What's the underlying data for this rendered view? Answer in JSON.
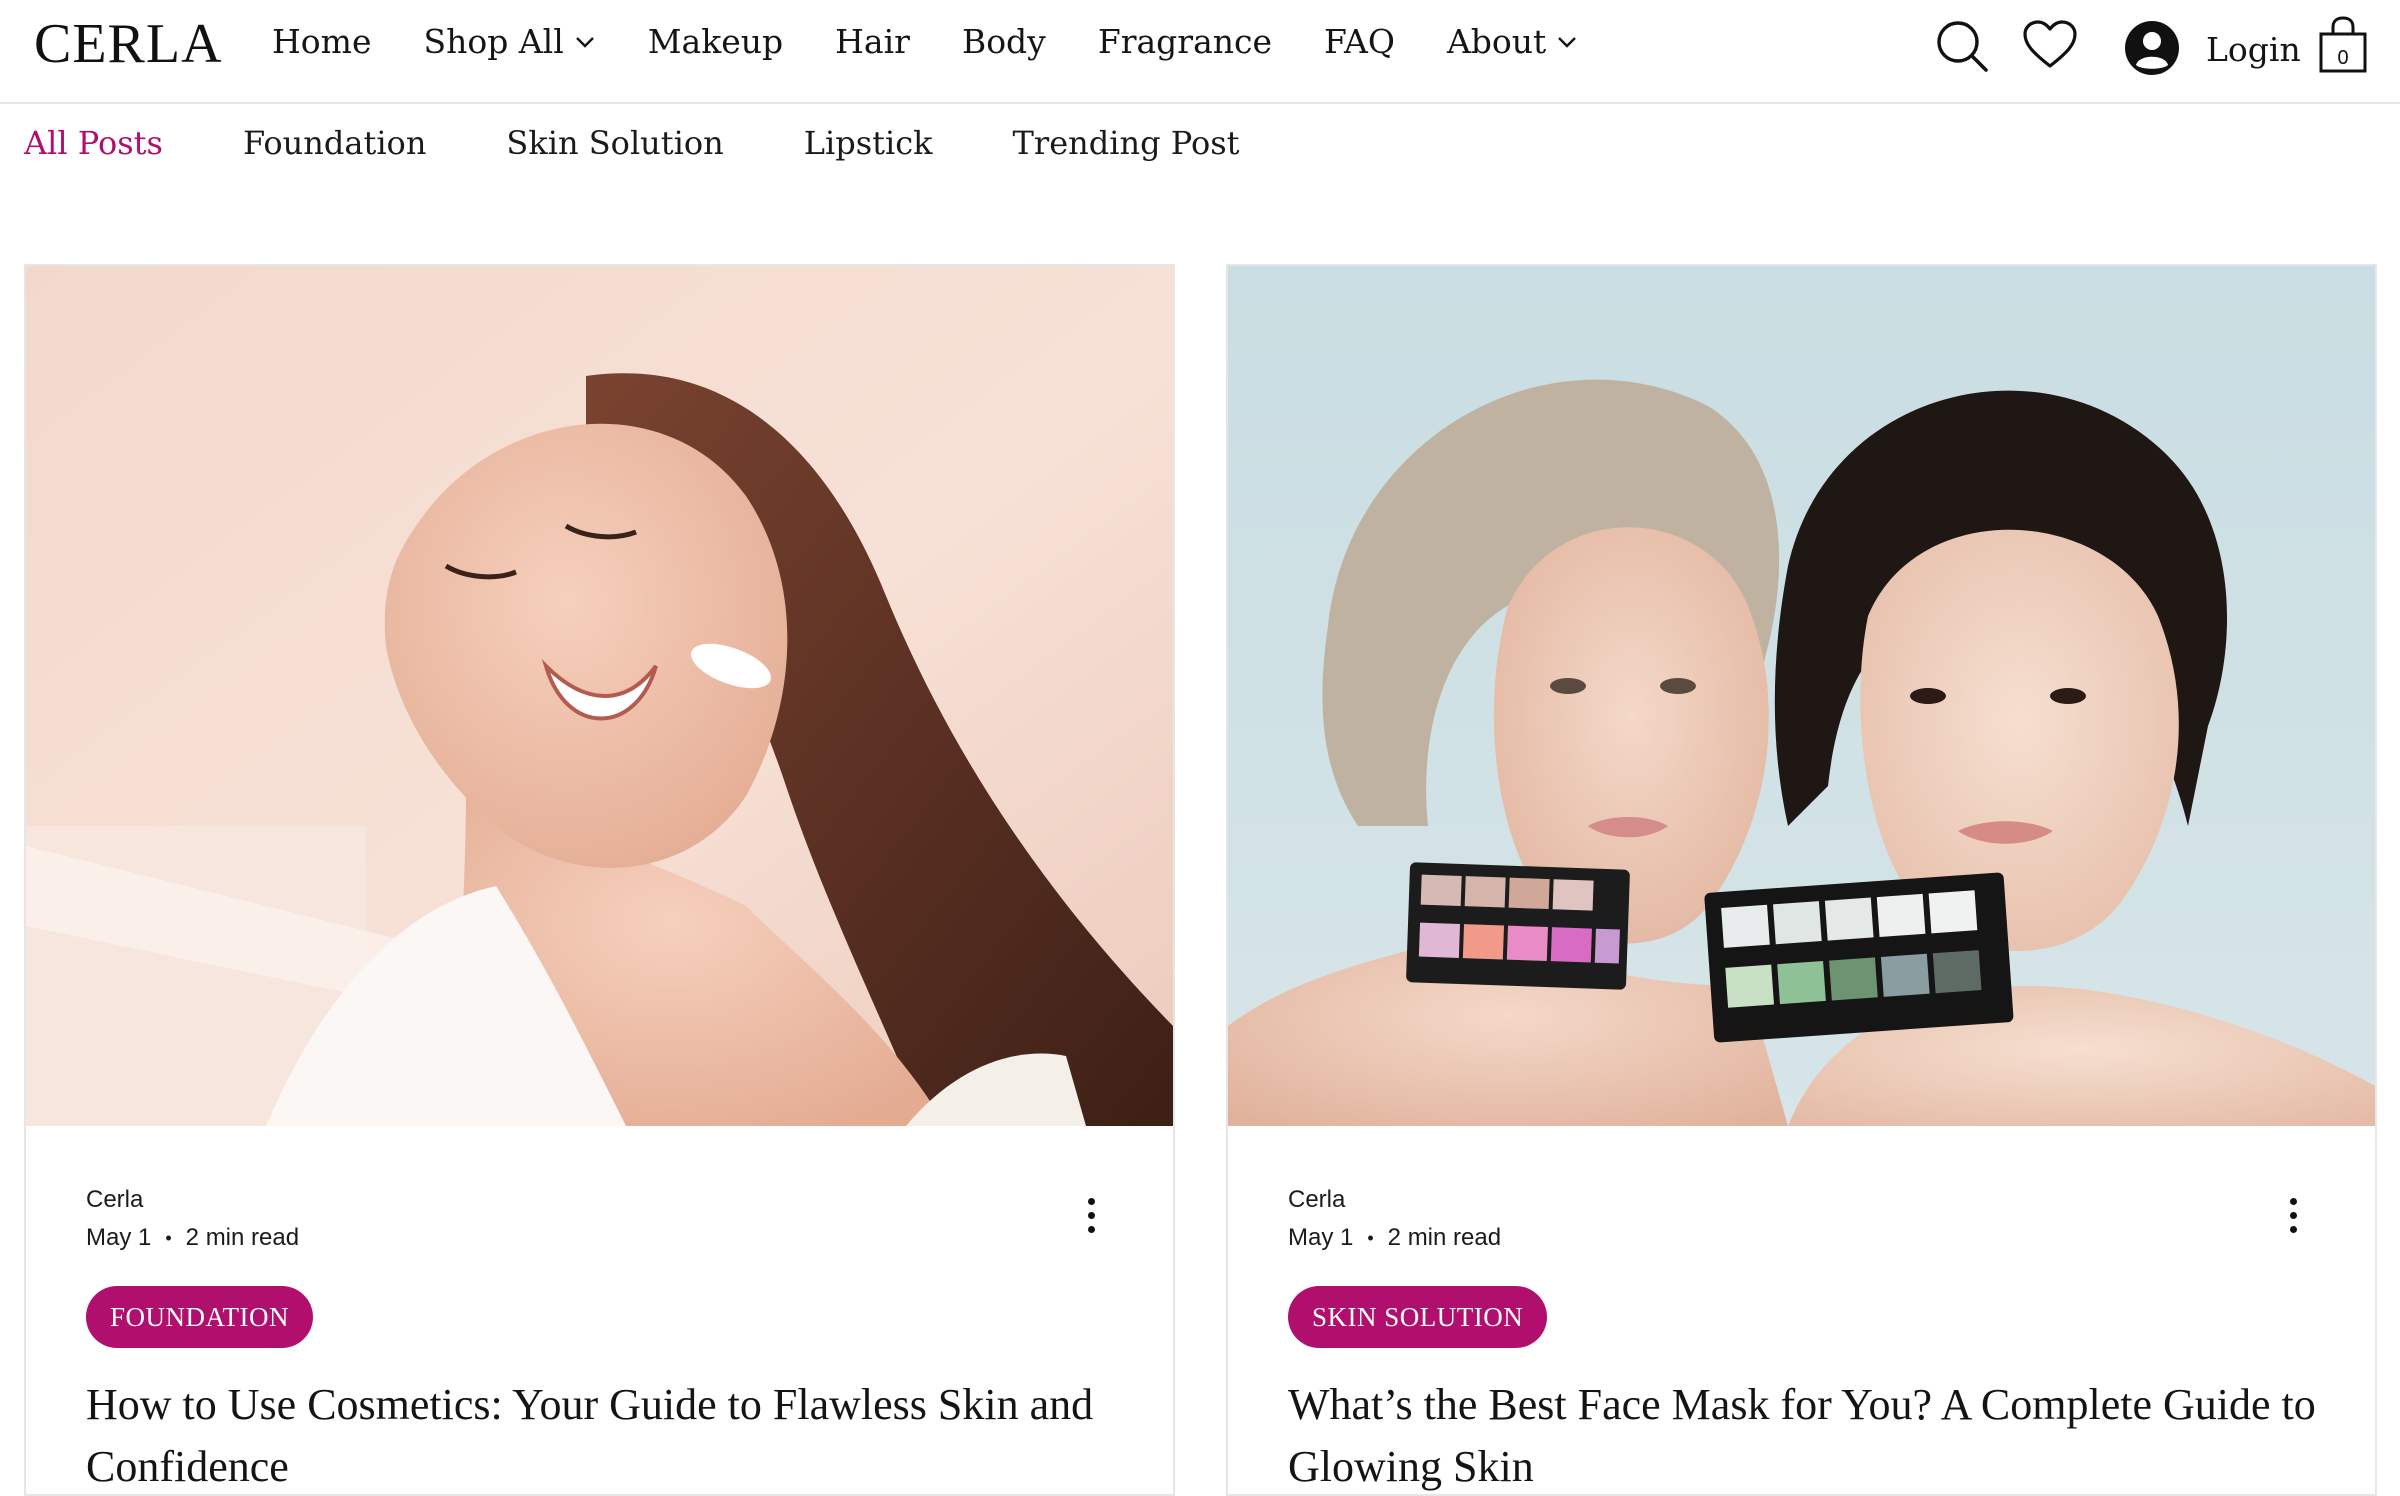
{
  "header": {
    "logo": "CERLA",
    "nav": [
      {
        "label": "Home",
        "dropdown": false
      },
      {
        "label": "Shop All",
        "dropdown": true
      },
      {
        "label": "Makeup",
        "dropdown": false
      },
      {
        "label": "Hair",
        "dropdown": false
      },
      {
        "label": "Body",
        "dropdown": false
      },
      {
        "label": "Fragrance",
        "dropdown": false
      },
      {
        "label": "FAQ",
        "dropdown": false
      },
      {
        "label": "About",
        "dropdown": true
      }
    ],
    "login_label": "Login",
    "cart_count": "0",
    "icons": [
      "search-icon",
      "heart-icon",
      "account-icon",
      "shopping-bag-icon"
    ]
  },
  "tabs": [
    {
      "label": "All Posts",
      "active": true
    },
    {
      "label": "Foundation",
      "active": false
    },
    {
      "label": "Skin Solution",
      "active": false
    },
    {
      "label": "Lipstick",
      "active": false
    },
    {
      "label": "Trending Post",
      "active": false
    }
  ],
  "posts": [
    {
      "author": "Cerla",
      "date": "May 1",
      "read_time": "2 min read",
      "category": "FOUNDATION",
      "title": "How to Use Cosmetics: Your Guide to Flawless Skin and Confidence"
    },
    {
      "author": "Cerla",
      "date": "May 1",
      "read_time": "2 min read",
      "category": "SKIN SOLUTION",
      "title": "What’s the Best Face Mask for You? A Complete Guide to Glowing Skin"
    }
  ],
  "colors": {
    "accent": "#b10f6e",
    "text": "#141414",
    "border": "#e6e6e6"
  }
}
